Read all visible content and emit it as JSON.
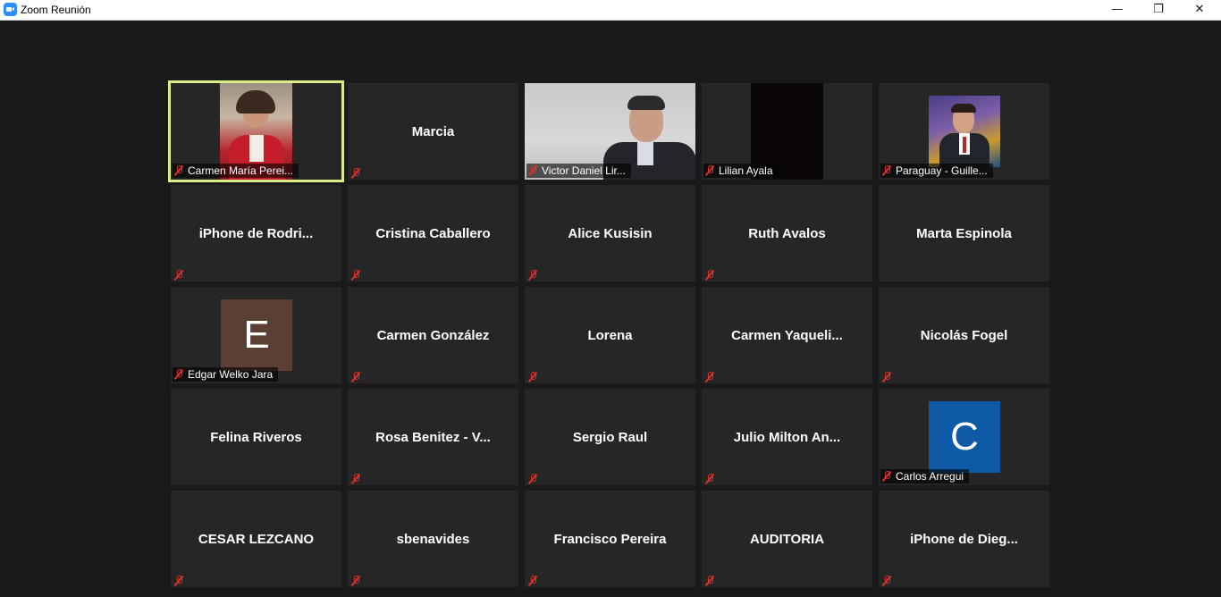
{
  "window": {
    "title": "Zoom Reunión",
    "minimize_icon": "minimize-icon",
    "restore_icon": "restore-icon",
    "close_icon": "close-icon"
  },
  "participants": [
    {
      "name": "Carmen María Perei...",
      "muted": true,
      "type": "video",
      "active": true
    },
    {
      "name": "Marcia",
      "muted": true,
      "type": "name"
    },
    {
      "name": "Victor Daniel Lir...",
      "muted": true,
      "type": "video"
    },
    {
      "name": "Lilian Ayala",
      "muted": true,
      "type": "video"
    },
    {
      "name": "Paraguay - Guille...",
      "muted": true,
      "type": "video"
    },
    {
      "name": "iPhone  de  Rodri...",
      "muted": true,
      "type": "name"
    },
    {
      "name": "Cristina Caballero",
      "muted": true,
      "type": "name"
    },
    {
      "name": "Alice Kusisin",
      "muted": true,
      "type": "name"
    },
    {
      "name": "Ruth Avalos",
      "muted": true,
      "type": "name"
    },
    {
      "name": "Marta Espinola",
      "muted": false,
      "type": "name"
    },
    {
      "name": "Edgar Welko Jara",
      "muted": true,
      "type": "avatar",
      "initial": "E",
      "avatar_color": "#5b3f34"
    },
    {
      "name": "Carmen González",
      "muted": true,
      "type": "name"
    },
    {
      "name": "Lorena",
      "muted": true,
      "type": "name"
    },
    {
      "name": "Carmen  Yaqueli...",
      "muted": true,
      "type": "name"
    },
    {
      "name": "Nicolás Fogel",
      "muted": true,
      "type": "name"
    },
    {
      "name": "Felina Riveros",
      "muted": false,
      "type": "name"
    },
    {
      "name": "Rosa Benitez - V...",
      "muted": true,
      "type": "name"
    },
    {
      "name": "Sergio Raul",
      "muted": true,
      "type": "name"
    },
    {
      "name": "Julio  Milton  An...",
      "muted": true,
      "type": "name"
    },
    {
      "name": "Carlos Arregui",
      "muted": true,
      "type": "avatar",
      "initial": "C",
      "avatar_color": "#0e5aa7"
    },
    {
      "name": "CESAR LEZCANO",
      "muted": true,
      "type": "name"
    },
    {
      "name": "sbenavides",
      "muted": true,
      "type": "name"
    },
    {
      "name": "Francisco Pereira",
      "muted": true,
      "type": "name"
    },
    {
      "name": "AUDITORIA",
      "muted": true,
      "type": "name"
    },
    {
      "name": "iPhone  de  Dieg...",
      "muted": true,
      "type": "name"
    }
  ],
  "colors": {
    "background": "#1a1a1a",
    "tile": "#262626",
    "active_speaker_border": "#d9ec88",
    "muted_icon": "#e0302b"
  }
}
